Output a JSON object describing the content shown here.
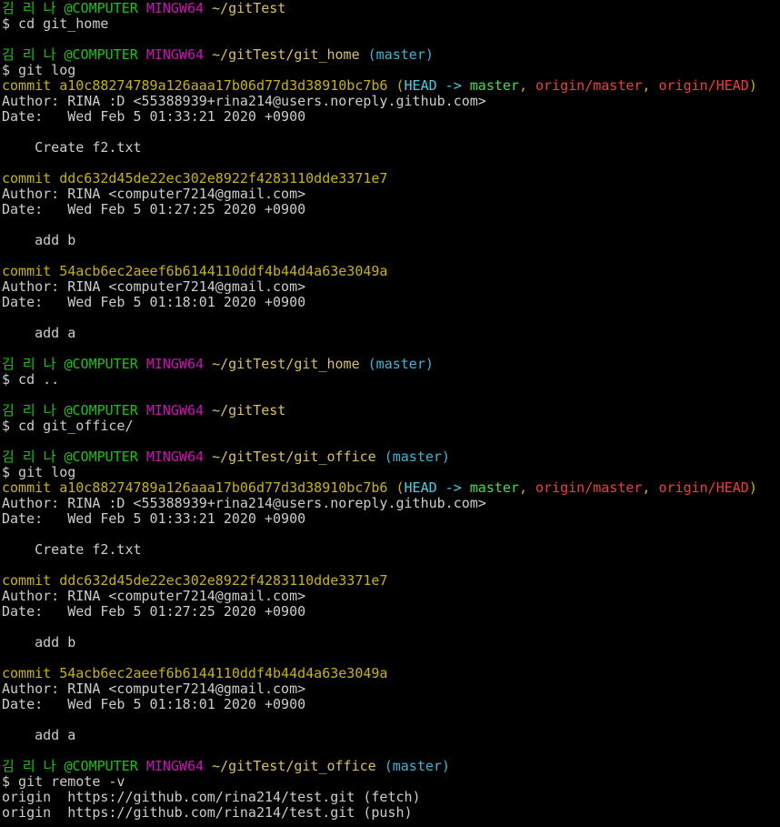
{
  "colors": {
    "default": "#c0c0c0",
    "green": "#16c60c",
    "magenta": "#b4009e",
    "yellow": "#c19c00",
    "cyan": "#3a96dd",
    "bright_cyan": "#61d6d6",
    "bright_green": "#13a10e",
    "red": "#e74856",
    "dark_yellow": "#c19c00",
    "commit": "#c8b400",
    "head_cyan": "#3ad4e6",
    "branch_green": "#3be33b",
    "origin_red": "#f23c3c"
  },
  "lines": [
    [
      {
        "t": "김 리 나 @COMPUTER ",
        "c": "green"
      },
      {
        "t": "MINGW64 ",
        "c": "magenta"
      },
      {
        "t": "~/gitTest",
        "c": "yellow"
      }
    ],
    [
      {
        "t": "$ cd git_home",
        "c": "default"
      }
    ],
    [],
    [
      {
        "t": "김 리 나 @COMPUTER ",
        "c": "green"
      },
      {
        "t": "MINGW64 ",
        "c": "magenta"
      },
      {
        "t": "~/gitTest/git_home",
        "c": "yellow"
      },
      {
        "t": " (master)",
        "c": "cyan"
      }
    ],
    [
      {
        "t": "$ git log",
        "c": "default"
      }
    ],
    [
      {
        "t": "commit a10c88274789a126aaa17b06d77d3d38910bc7b6 (",
        "c": "commit"
      },
      {
        "t": "HEAD -> ",
        "c": "head_cyan"
      },
      {
        "t": "master",
        "c": "branch_green"
      },
      {
        "t": ", ",
        "c": "commit"
      },
      {
        "t": "origin/master",
        "c": "origin_red"
      },
      {
        "t": ", ",
        "c": "commit"
      },
      {
        "t": "origin/HEAD",
        "c": "origin_red"
      },
      {
        "t": ")",
        "c": "commit"
      }
    ],
    [
      {
        "t": "Author: RINA :D <55388939+rina214@users.noreply.github.com>",
        "c": "default"
      }
    ],
    [
      {
        "t": "Date:   Wed Feb 5 01:33:21 2020 +0900",
        "c": "default"
      }
    ],
    [],
    [
      {
        "t": "    Create f2.txt",
        "c": "default"
      }
    ],
    [],
    [
      {
        "t": "commit ddc632d45de22ec302e8922f4283110dde3371e7",
        "c": "commit"
      }
    ],
    [
      {
        "t": "Author: RINA <computer7214@gmail.com>",
        "c": "default"
      }
    ],
    [
      {
        "t": "Date:   Wed Feb 5 01:27:25 2020 +0900",
        "c": "default"
      }
    ],
    [],
    [
      {
        "t": "    add b",
        "c": "default"
      }
    ],
    [],
    [
      {
        "t": "commit 54acb6ec2aeef6b6144110ddf4b44d4a63e3049a",
        "c": "commit"
      }
    ],
    [
      {
        "t": "Author: RINA <computer7214@gmail.com>",
        "c": "default"
      }
    ],
    [
      {
        "t": "Date:   Wed Feb 5 01:18:01 2020 +0900",
        "c": "default"
      }
    ],
    [],
    [
      {
        "t": "    add a",
        "c": "default"
      }
    ],
    [],
    [
      {
        "t": "김 리 나 @COMPUTER ",
        "c": "green"
      },
      {
        "t": "MINGW64 ",
        "c": "magenta"
      },
      {
        "t": "~/gitTest/git_home",
        "c": "yellow"
      },
      {
        "t": " (master)",
        "c": "cyan"
      }
    ],
    [
      {
        "t": "$ cd ..",
        "c": "default"
      }
    ],
    [],
    [
      {
        "t": "김 리 나 @COMPUTER ",
        "c": "green"
      },
      {
        "t": "MINGW64 ",
        "c": "magenta"
      },
      {
        "t": "~/gitTest",
        "c": "yellow"
      }
    ],
    [
      {
        "t": "$ cd git_office/",
        "c": "default"
      }
    ],
    [],
    [
      {
        "t": "김 리 나 @COMPUTER ",
        "c": "green"
      },
      {
        "t": "MINGW64 ",
        "c": "magenta"
      },
      {
        "t": "~/gitTest/git_office",
        "c": "yellow"
      },
      {
        "t": " (master)",
        "c": "cyan"
      }
    ],
    [
      {
        "t": "$ git log",
        "c": "default"
      }
    ],
    [
      {
        "t": "commit a10c88274789a126aaa17b06d77d3d38910bc7b6 (",
        "c": "commit"
      },
      {
        "t": "HEAD -> ",
        "c": "head_cyan"
      },
      {
        "t": "master",
        "c": "branch_green"
      },
      {
        "t": ", ",
        "c": "commit"
      },
      {
        "t": "origin/master",
        "c": "origin_red"
      },
      {
        "t": ", ",
        "c": "commit"
      },
      {
        "t": "origin/HEAD",
        "c": "origin_red"
      },
      {
        "t": ")",
        "c": "commit"
      }
    ],
    [
      {
        "t": "Author: RINA :D <55388939+rina214@users.noreply.github.com>",
        "c": "default"
      }
    ],
    [
      {
        "t": "Date:   Wed Feb 5 01:33:21 2020 +0900",
        "c": "default"
      }
    ],
    [],
    [
      {
        "t": "    Create f2.txt",
        "c": "default"
      }
    ],
    [],
    [
      {
        "t": "commit ddc632d45de22ec302e8922f4283110dde3371e7",
        "c": "commit"
      }
    ],
    [
      {
        "t": "Author: RINA <computer7214@gmail.com>",
        "c": "default"
      }
    ],
    [
      {
        "t": "Date:   Wed Feb 5 01:27:25 2020 +0900",
        "c": "default"
      }
    ],
    [],
    [
      {
        "t": "    add b",
        "c": "default"
      }
    ],
    [],
    [
      {
        "t": "commit 54acb6ec2aeef6b6144110ddf4b44d4a63e3049a",
        "c": "commit"
      }
    ],
    [
      {
        "t": "Author: RINA <computer7214@gmail.com>",
        "c": "default"
      }
    ],
    [
      {
        "t": "Date:   Wed Feb 5 01:18:01 2020 +0900",
        "c": "default"
      }
    ],
    [],
    [
      {
        "t": "    add a",
        "c": "default"
      }
    ],
    [],
    [
      {
        "t": "김 리 나 @COMPUTER ",
        "c": "green"
      },
      {
        "t": "MINGW64 ",
        "c": "magenta"
      },
      {
        "t": "~/gitTest/git_office",
        "c": "yellow"
      },
      {
        "t": " (master)",
        "c": "cyan"
      }
    ],
    [
      {
        "t": "$ git remote -v",
        "c": "default"
      }
    ],
    [
      {
        "t": "origin  https://github.com/rina214/test.git (fetch)",
        "c": "default"
      }
    ],
    [
      {
        "t": "origin  https://github.com/rina214/test.git (push)",
        "c": "default"
      }
    ]
  ]
}
